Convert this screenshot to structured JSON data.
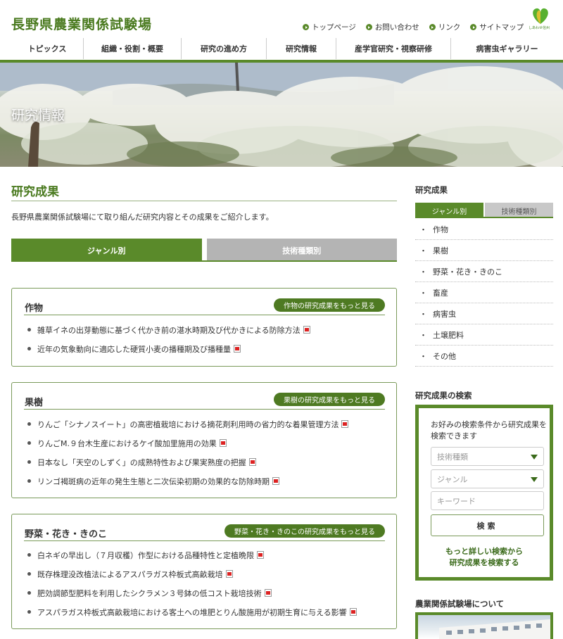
{
  "site": {
    "title": "長野県農業関係試験場",
    "logo_text": "しあわせ信州"
  },
  "util_nav": [
    "トップページ",
    "お問い合わせ",
    "リンク",
    "サイトマップ"
  ],
  "global_nav": [
    "トピックス",
    "組織・役割・概要",
    "研究の進め方",
    "研究情報",
    "産学官研究・視察研修",
    "病害虫ギャラリー"
  ],
  "hero": {
    "title": "研究情報"
  },
  "main": {
    "heading": "研究成果",
    "intro": "長野県農業関係試験場にて取り組んだ研究内容とその成果をご紹介します。",
    "tabs": [
      "ジャンル別",
      "技術種類別"
    ],
    "sections": [
      {
        "title": "作物",
        "more": "作物の研究成果をもっと見る",
        "items": [
          "雑草イネの出芽動態に基づく代かき前の湛水時期及び代かきによる防除方法",
          "近年の気象動向に適応した硬質小麦の播種期及び播種量"
        ]
      },
      {
        "title": "果樹",
        "more": "果樹の研究成果をもっと見る",
        "items": [
          "りんご「シナノスイート」の高密植栽培における摘花剤利用時の省力的な着果管理方法",
          "りんごM.９台木生産におけるケイ酸加里施用の効果",
          "日本なし「天空のしずく」の成熟特性および果実熟度の把握",
          "リンゴ褐斑病の近年の発生生態と二次伝染初期の効果的な防除時期"
        ]
      },
      {
        "title": "野菜・花き・きのこ",
        "more": "野菜・花き・きのこの研究成果をもっと見る",
        "items": [
          "白ネギの早出し（７月収穫）作型における品種特性と定植晩限",
          "既存株理没改植法によるアスパラガス枠板式高畝栽培",
          "肥効調節型肥料を利用したシクラメン３号鉢の低コスト栽培技術",
          "アスパラガス枠板式高畝栽培における客土への堆肥とりん酸施用が初期生育に与える影響"
        ]
      }
    ]
  },
  "sidebar": {
    "results_heading": "研究成果",
    "tabs": [
      "ジャンル別",
      "技術種類別"
    ],
    "genres": [
      "作物",
      "果樹",
      "野菜・花き・きのこ",
      "畜産",
      "病害虫",
      "土壌肥料",
      "その他"
    ],
    "search": {
      "heading": "研究成果の検索",
      "description": "お好みの検索条件から研究成果を検索できます",
      "tech_type_placeholder": "技術種類",
      "genre_placeholder": "ジャンル",
      "keyword_placeholder": "キーワード",
      "button": "検索",
      "advanced_line1": "もっと詳しい検索から",
      "advanced_line2": "研究成果を検索する"
    },
    "about_heading": "農業関係試験場について"
  },
  "colors": {
    "accent": "#5a8a2a",
    "title_green": "#4a7a1f",
    "button_green": "#4e7a22",
    "tab_inactive": "#b4b4b4"
  }
}
